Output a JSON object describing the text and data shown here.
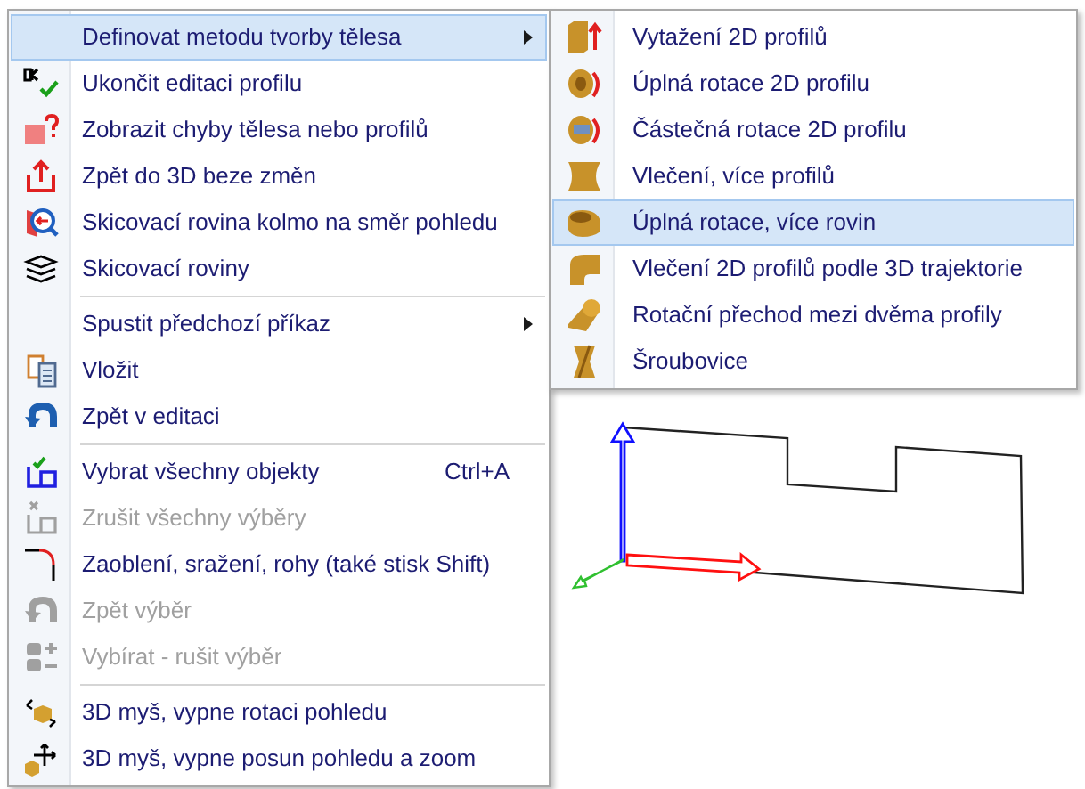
{
  "menu": {
    "items": [
      {
        "kind": "item",
        "label": "Definovat metodu tvorby tělesa",
        "selected": true,
        "disabled": false,
        "submenu": true
      },
      {
        "kind": "item",
        "label": "Ukončit editaci profilu",
        "selected": false,
        "disabled": false,
        "submenu": false
      },
      {
        "kind": "item",
        "label": "Zobrazit chyby tělesa nebo profilů",
        "selected": false,
        "disabled": false,
        "submenu": false
      },
      {
        "kind": "item",
        "label": "Zpět do 3D beze změn",
        "selected": false,
        "disabled": false,
        "submenu": false
      },
      {
        "kind": "item",
        "label": "Skicovací rovina kolmo na směr pohledu",
        "selected": false,
        "disabled": false,
        "submenu": false
      },
      {
        "kind": "item",
        "label": "Skicovací roviny",
        "selected": false,
        "disabled": false,
        "submenu": false
      },
      {
        "kind": "separator"
      },
      {
        "kind": "item",
        "label": "Spustit předchozí příkaz",
        "selected": false,
        "disabled": false,
        "submenu": true
      },
      {
        "kind": "item",
        "label": "Vložit",
        "selected": false,
        "disabled": false,
        "submenu": false
      },
      {
        "kind": "item",
        "label": "Zpět v editaci",
        "selected": false,
        "disabled": false,
        "submenu": false
      },
      {
        "kind": "separator"
      },
      {
        "kind": "item",
        "label": "Vybrat všechny objekty",
        "shortcut": "Ctrl+A",
        "selected": false,
        "disabled": false,
        "submenu": false
      },
      {
        "kind": "item",
        "label": "Zrušit všechny výběry",
        "selected": false,
        "disabled": true,
        "submenu": false
      },
      {
        "kind": "item",
        "label": "Zaoblení, sražení, rohy (také stisk Shift)",
        "selected": false,
        "disabled": false,
        "submenu": false
      },
      {
        "kind": "item",
        "label": "Zpět výběr",
        "selected": false,
        "disabled": true,
        "submenu": false
      },
      {
        "kind": "item",
        "label": "Vybírat - rušit výběr",
        "selected": false,
        "disabled": true,
        "submenu": false
      },
      {
        "kind": "separator"
      },
      {
        "kind": "item",
        "label": "3D myš, vypne rotaci pohledu",
        "selected": false,
        "disabled": false,
        "submenu": false
      },
      {
        "kind": "item",
        "label": "3D myš, vypne posun pohledu a zoom",
        "selected": false,
        "disabled": false,
        "submenu": false
      }
    ]
  },
  "submenu": {
    "items": [
      {
        "label": "Vytažení 2D profilů",
        "selected": false
      },
      {
        "label": "Úplná rotace 2D profilu",
        "selected": false
      },
      {
        "label": "Částečná rotace 2D profilu",
        "selected": false
      },
      {
        "label": "Vlečení, více profilů",
        "selected": false
      },
      {
        "label": "Úplná rotace, více rovin",
        "selected": true
      },
      {
        "label": "Vlečení 2D profilů podle 3D trajektorie",
        "selected": false
      },
      {
        "label": "Rotační přechod mezi dvěma profily",
        "selected": false
      },
      {
        "label": "Šroubovice",
        "selected": false
      }
    ]
  }
}
